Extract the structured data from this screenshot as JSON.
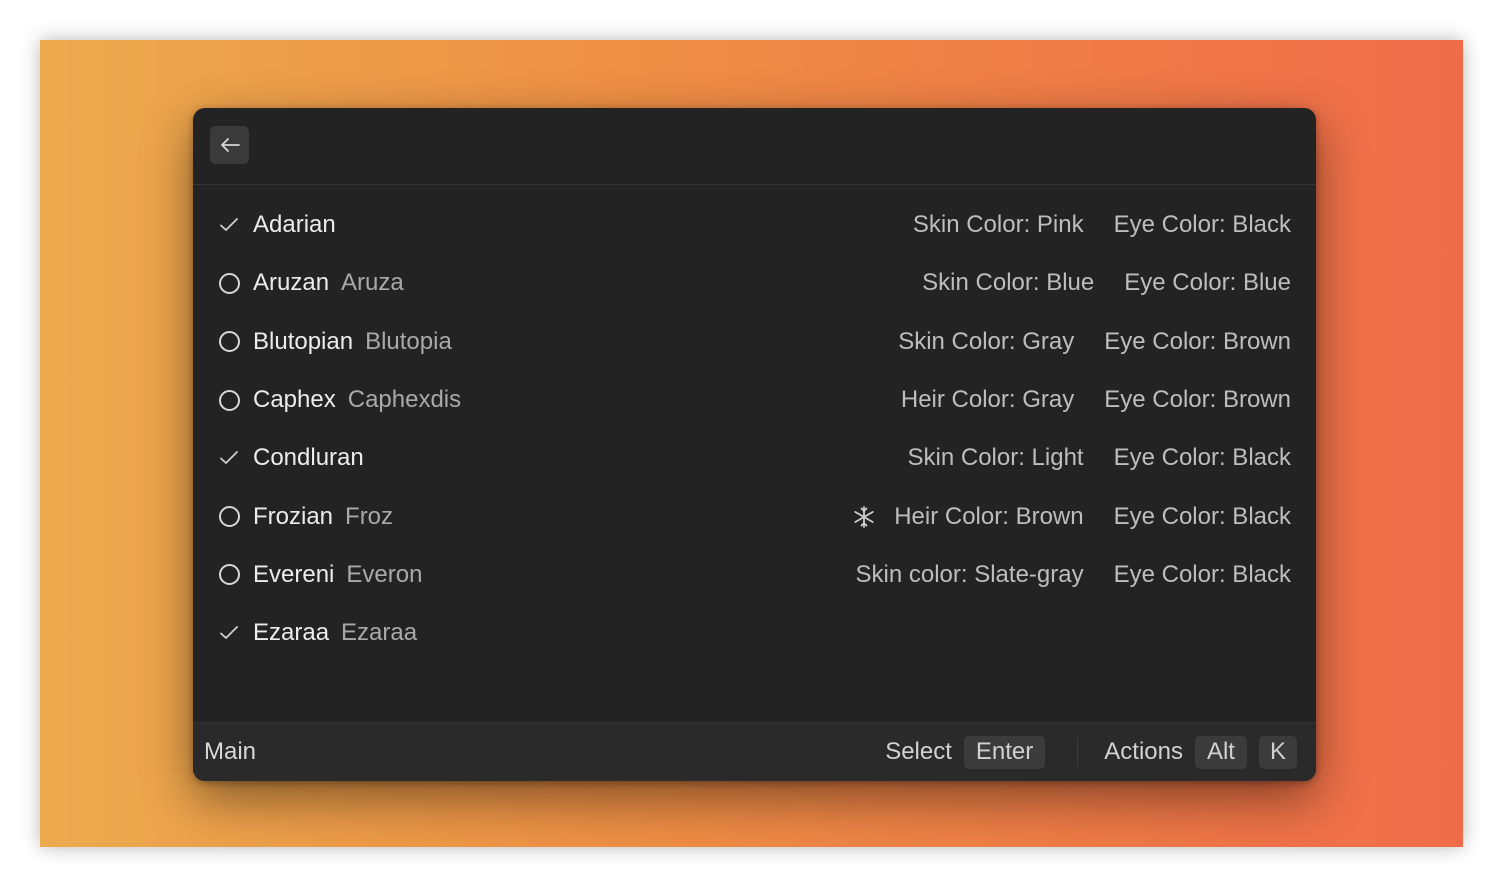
{
  "window": {
    "back_button_icon": "arrow-left-icon"
  },
  "items": [
    {
      "status": "check",
      "title": "Adarian",
      "subtitle": "",
      "icon": "",
      "acc1": "Skin Color: Pink",
      "acc2": "Eye Color: Black"
    },
    {
      "status": "circle",
      "title": "Aruzan",
      "subtitle": "Aruza",
      "icon": "",
      "acc1": "Skin Color: Blue",
      "acc2": "Eye Color: Blue"
    },
    {
      "status": "circle",
      "title": "Blutopian",
      "subtitle": "Blutopia",
      "icon": "",
      "acc1": "Skin Color: Gray",
      "acc2": "Eye Color: Brown"
    },
    {
      "status": "circle",
      "title": "Caphex",
      "subtitle": "Caphexdis",
      "icon": "",
      "acc1": "Heir Color: Gray",
      "acc2": "Eye Color: Brown"
    },
    {
      "status": "check",
      "title": "Condluran",
      "subtitle": "",
      "icon": "",
      "acc1": "Skin Color: Light",
      "acc2": "Eye Color: Black"
    },
    {
      "status": "circle",
      "title": "Frozian",
      "subtitle": "Froz",
      "icon": "snowflake-icon",
      "acc1": "Heir Color: Brown",
      "acc2": "Eye Color: Black"
    },
    {
      "status": "circle",
      "title": "Evereni",
      "subtitle": "Everon",
      "icon": "",
      "acc1": "Skin color: Slate-gray",
      "acc2": "Eye Color: Black"
    },
    {
      "status": "check",
      "title": "Ezaraa",
      "subtitle": "Ezaraa",
      "icon": "",
      "acc1": "",
      "acc2": ""
    }
  ],
  "footer": {
    "title": "Main",
    "primary_action": "Select",
    "primary_key": "Enter",
    "actions_label": "Actions",
    "actions_key_1": "Alt",
    "actions_key_2": "K"
  },
  "colors": {
    "background_gradient_start": "#ecaa4e",
    "background_gradient_end": "#f06c49",
    "window_bg": "#232323",
    "footer_bg": "#2a2a2a"
  }
}
